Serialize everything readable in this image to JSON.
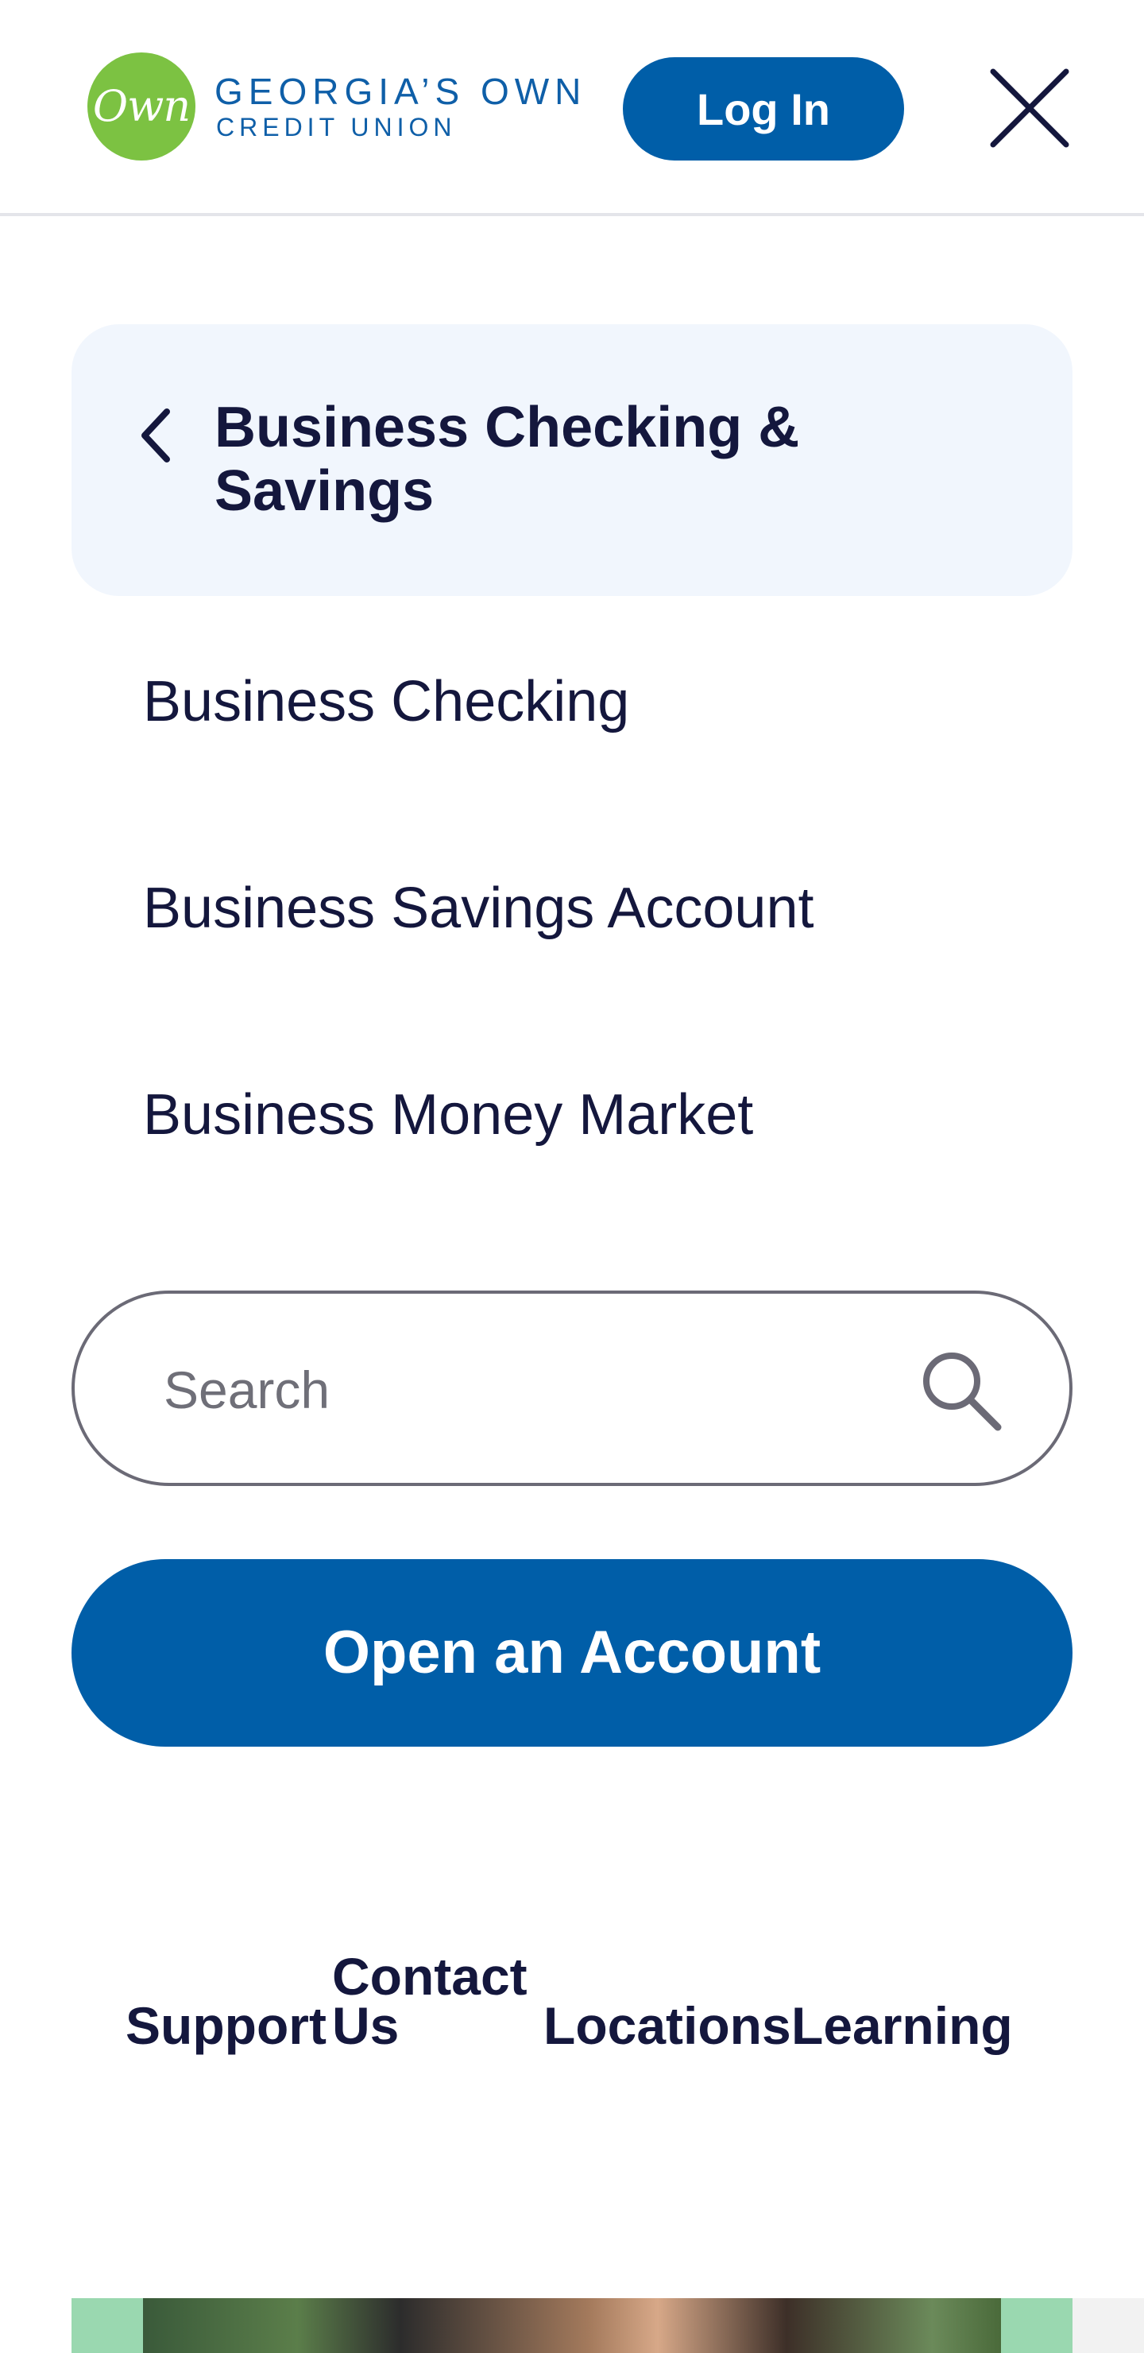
{
  "header": {
    "logo_mark": "Own",
    "logo_line1": "GEORGIA’S OWN",
    "logo_line2": "CREDIT UNION",
    "login_label": "Log In"
  },
  "menu": {
    "back_title": "Business Checking & Savings",
    "items": [
      {
        "label": "Business Checking"
      },
      {
        "label": "Business Savings Account"
      },
      {
        "label": "Business Money Market"
      }
    ]
  },
  "search": {
    "placeholder": "Search",
    "value": ""
  },
  "cta": {
    "open_account_label": "Open an Account"
  },
  "utility_nav": {
    "support": "Support",
    "contact_line1": "Contact",
    "contact_line2": "Us",
    "locations": "Locations",
    "learning": "Learning"
  },
  "colors": {
    "brand_blue": "#005ea8",
    "brand_green": "#7cc242",
    "text_navy": "#14173d",
    "crumb_bg": "#f1f6fd"
  },
  "icons": [
    "chevron-left-icon",
    "close-icon",
    "search-icon"
  ]
}
